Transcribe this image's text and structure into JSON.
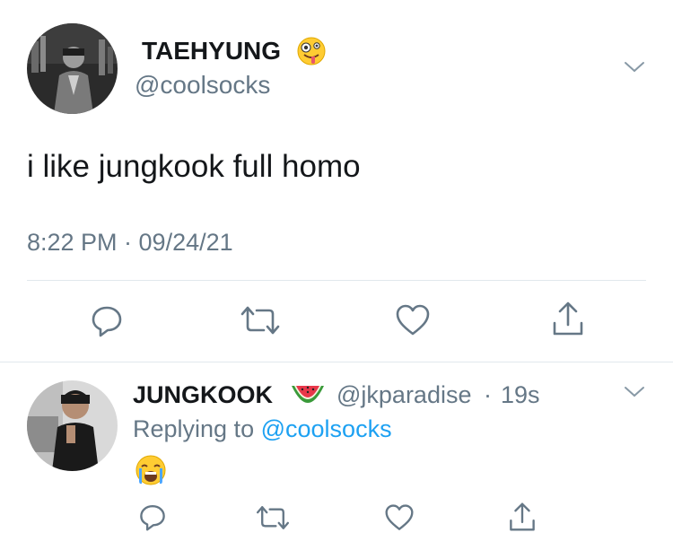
{
  "tweet": {
    "author": {
      "name": "TAEHYUNG",
      "name_emoji": "zany-face-emoji",
      "handle": "@coolsocks"
    },
    "text": "i like jungkook full homo",
    "timestamp": "8:22 PM · 09/24/21",
    "actions": [
      "reply-icon",
      "retweet-icon",
      "like-icon",
      "share-icon"
    ]
  },
  "reply": {
    "author": {
      "name": "JUNGKOOK",
      "name_emoji": "watermelon-emoji",
      "handle": "@jkparadise",
      "time": "19s"
    },
    "replying_prefix": "Replying to",
    "replying_handle": "@coolsocks",
    "content_emoji": "loudly-crying-face-emoji",
    "actions": [
      "reply-icon",
      "retweet-icon",
      "like-icon",
      "share-icon"
    ]
  },
  "colors": {
    "text": "#14171a",
    "secondary": "#657786",
    "accent": "#1da1f2",
    "divider": "#e1e8ed"
  }
}
